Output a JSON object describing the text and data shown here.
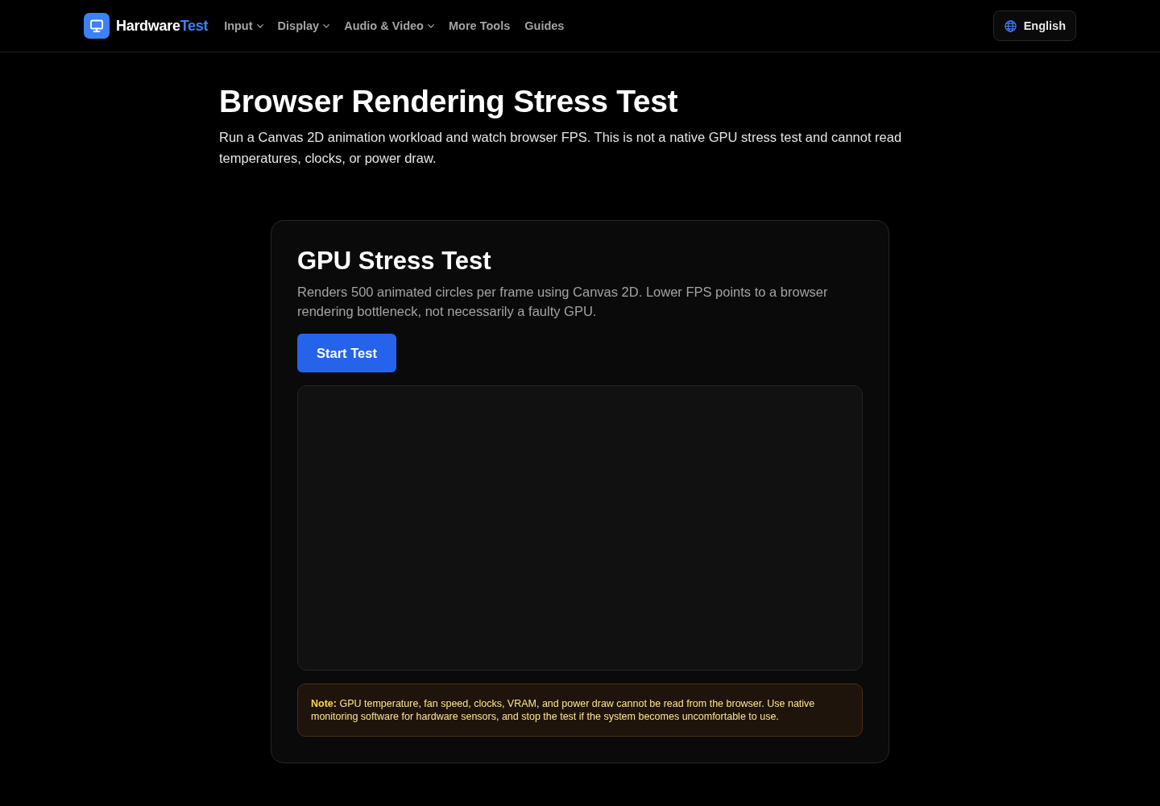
{
  "header": {
    "logo": {
      "name_part": "Hardware",
      "accent_part": "Test"
    },
    "nav": [
      {
        "label": "Input",
        "dropdown": true
      },
      {
        "label": "Display",
        "dropdown": true
      },
      {
        "label": "Audio & Video",
        "dropdown": true
      },
      {
        "label": "More Tools",
        "dropdown": false
      },
      {
        "label": "Guides",
        "dropdown": false
      }
    ],
    "language_button": {
      "label": "English"
    }
  },
  "page": {
    "title": "Browser Rendering Stress Test",
    "subtitle": "Run a Canvas 2D animation workload and watch browser FPS. This is not a native GPU stress test and cannot read temperatures, clocks, or power draw."
  },
  "card": {
    "title": "GPU Stress Test",
    "description": "Renders 500 animated circles per frame using Canvas 2D. Lower FPS points to a browser rendering bottleneck, not necessarily a faulty GPU.",
    "start_button": "Start Test",
    "note": "**Note:** GPU temperature, fan speed, clocks, VRAM, and power draw cannot be read from the browser. Use native monitoring software for hardware sensors, and stop the test if the system becomes uncomfortable to use."
  }
}
